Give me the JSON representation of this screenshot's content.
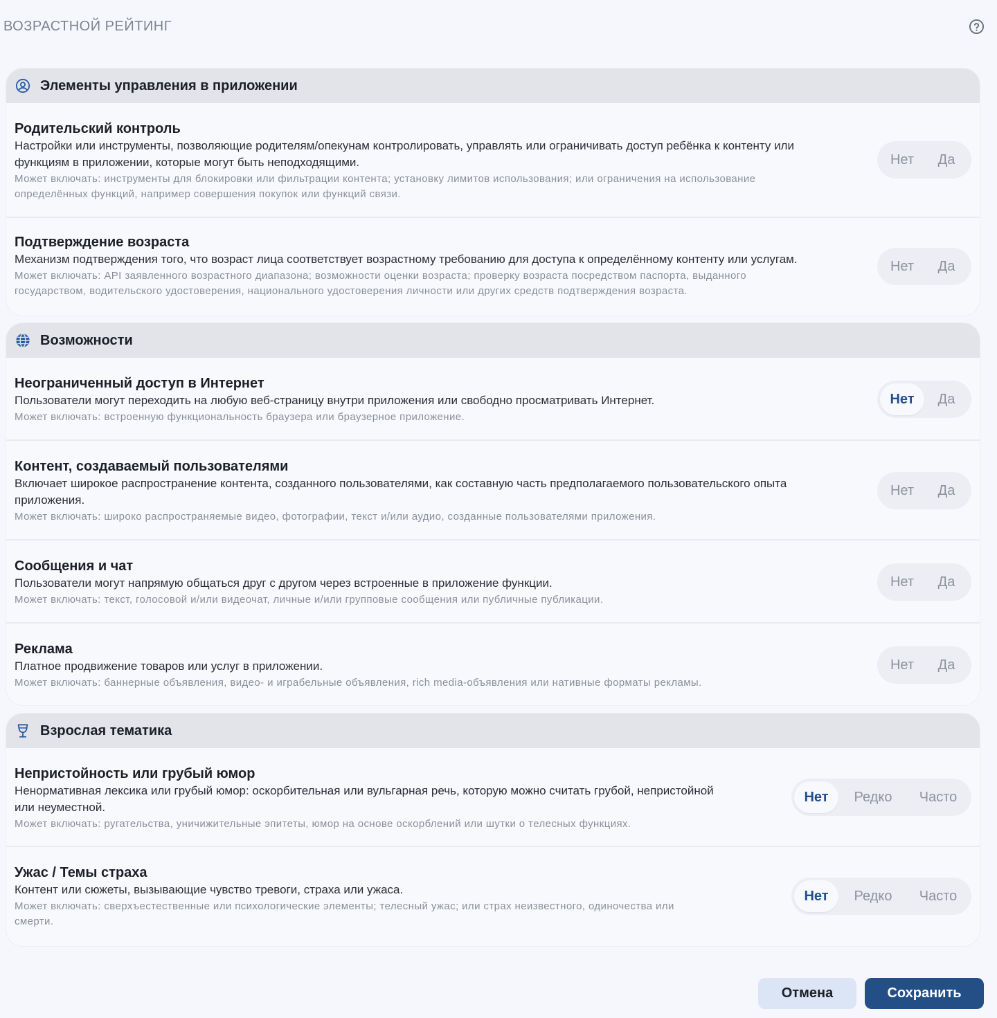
{
  "page": {
    "title": "ВОЗРАСТНОЙ РЕЙТИНГ",
    "help_icon": "question-circle-icon"
  },
  "sections": [
    {
      "title": "Элементы управления в приложении",
      "icon": "user-circle-icon",
      "rows": [
        {
          "title": "Родительский контроль",
          "desc": [
            "Настройки или инструменты, позволяющие родителям/опекунам контролировать, управлять или ограничивать доступ ребёнка к контенту или",
            "функциям в приложении, которые могут быть неподходящими."
          ],
          "hint": [
            "Может включать: инструменты для блокировки или фильтрации контента; установку лимитов использования; или ограничения на использование",
            "определённых функций, например совершения покупок или функций связи."
          ],
          "options": [
            "Нет",
            "Да"
          ],
          "selected": null
        },
        {
          "title": "Подтверждение возраста",
          "desc": [
            "Механизм подтверждения того, что возраст лица соответствует возрастному требованию для доступа к определённому контенту или услугам."
          ],
          "hint": [
            "Может включать: API заявленного возрастного диапазона; возможности оценки возраста; проверку возраста посредством паспорта, выданного",
            "государством, водительского удостоверения, национального удостоверения личности или других средств подтверждения возраста."
          ],
          "options": [
            "Нет",
            "Да"
          ],
          "selected": null
        }
      ]
    },
    {
      "title": "Возможности",
      "icon": "globe-icon",
      "rows": [
        {
          "title": "Неограниченный доступ в Интернет",
          "desc": [
            "Пользователи могут переходить на любую веб-страницу внутри приложения или свободно просматривать Интернет."
          ],
          "hint": [
            "Может включать: встроенную функциональность браузера или браузерное приложение."
          ],
          "options": [
            "Нет",
            "Да"
          ],
          "selected": "Нет"
        },
        {
          "title": "Контент, создаваемый пользователями",
          "desc": [
            "Включает широкое распространение контента, созданного пользователями, как составную часть предполагаемого пользовательского опыта",
            "приложения."
          ],
          "hint": [
            "Может включать: широко распространяемые видео, фотографии, текст и/или аудио, созданные пользователями приложения."
          ],
          "options": [
            "Нет",
            "Да"
          ],
          "selected": null
        },
        {
          "title": "Сообщения и чат",
          "desc": [
            "Пользователи могут напрямую общаться друг с другом через встроенные в приложение функции."
          ],
          "hint": [
            "Может включать: текст, голосовой и/или видеочат, личные и/или групповые сообщения или публичные публикации."
          ],
          "options": [
            "Нет",
            "Да"
          ],
          "selected": null
        },
        {
          "title": "Реклама",
          "desc": [
            "Платное продвижение товаров или услуг в приложении."
          ],
          "hint": [
            "Может включать: баннерные объявления, видео- и играбельные объявления, rich media-объявления или нативные форматы рекламы."
          ],
          "options": [
            "Нет",
            "Да"
          ],
          "selected": null
        }
      ]
    },
    {
      "title": "Взрослая тематика",
      "icon": "wine-glass-icon",
      "rows": [
        {
          "title": "Непристойность или грубый юмор",
          "desc": [
            "Ненормативная лексика или грубый юмор: оскорбительная или вульгарная речь, которую можно считать грубой, непристойной",
            "или неуместной."
          ],
          "hint": [
            "Может включать: ругательства, уничижительные эпитеты, юмор на основе оскорблений или шутки о телесных функциях."
          ],
          "options": [
            "Нет",
            "Редко",
            "Часто"
          ],
          "selected": "Нет"
        },
        {
          "title": "Ужас / Темы страха",
          "desc": [
            "Контент или сюжеты, вызывающие чувство тревоги, страха или ужаса."
          ],
          "hint": [
            "Может включать: сверхъестественные или психологические элементы; телесный ужас; или страх неизвестного, одиночества или",
            "смерти."
          ],
          "options": [
            "Нет",
            "Редко",
            "Часто"
          ],
          "selected": "Нет"
        }
      ]
    }
  ],
  "footer": {
    "cancel_label": "Отмена",
    "save_label": "Сохранить"
  },
  "colors": {
    "accent": "#234e86",
    "selected_text": "#1f4f8c",
    "header_bg": "#e2e4ea"
  }
}
